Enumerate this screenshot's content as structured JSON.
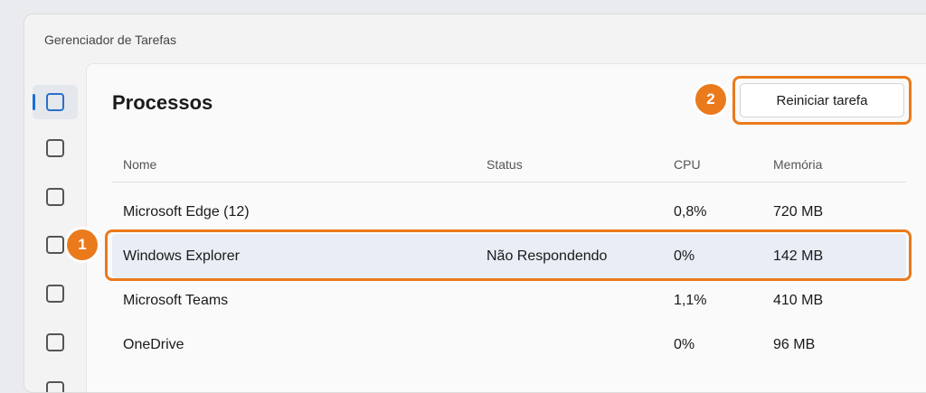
{
  "window": {
    "title": "Gerenciador de Tarefas"
  },
  "sidebar": {
    "items": [
      {
        "icon": "square-outline-icon",
        "active": true
      },
      {
        "icon": "square-outline-icon",
        "active": false
      },
      {
        "icon": "square-outline-icon",
        "active": false
      },
      {
        "icon": "square-outline-icon",
        "active": false
      },
      {
        "icon": "square-outline-icon",
        "active": false
      },
      {
        "icon": "square-outline-icon",
        "active": false
      }
    ]
  },
  "page": {
    "title": "Processos"
  },
  "toolbar": {
    "restart_label": "Reiniciar tarefa"
  },
  "annotations": {
    "badge_1": "1",
    "badge_2": "2",
    "highlight_color": "#ea7a1c"
  },
  "table": {
    "headers": {
      "name": "Nome",
      "status": "Status",
      "cpu": "CPU",
      "memory": "Memória"
    },
    "rows": [
      {
        "name": "Microsoft Edge (12)",
        "status": "",
        "cpu": "0,8%",
        "memory": "720 MB"
      },
      {
        "name": "Windows Explorer",
        "status": "Não Respondendo",
        "cpu": "0%",
        "memory": "142 MB",
        "selected": true
      },
      {
        "name": "Microsoft Teams",
        "status": "",
        "cpu": "1,1%",
        "memory": "410 MB"
      },
      {
        "name": "OneDrive",
        "status": "",
        "cpu": "0%",
        "memory": "96 MB"
      }
    ]
  }
}
